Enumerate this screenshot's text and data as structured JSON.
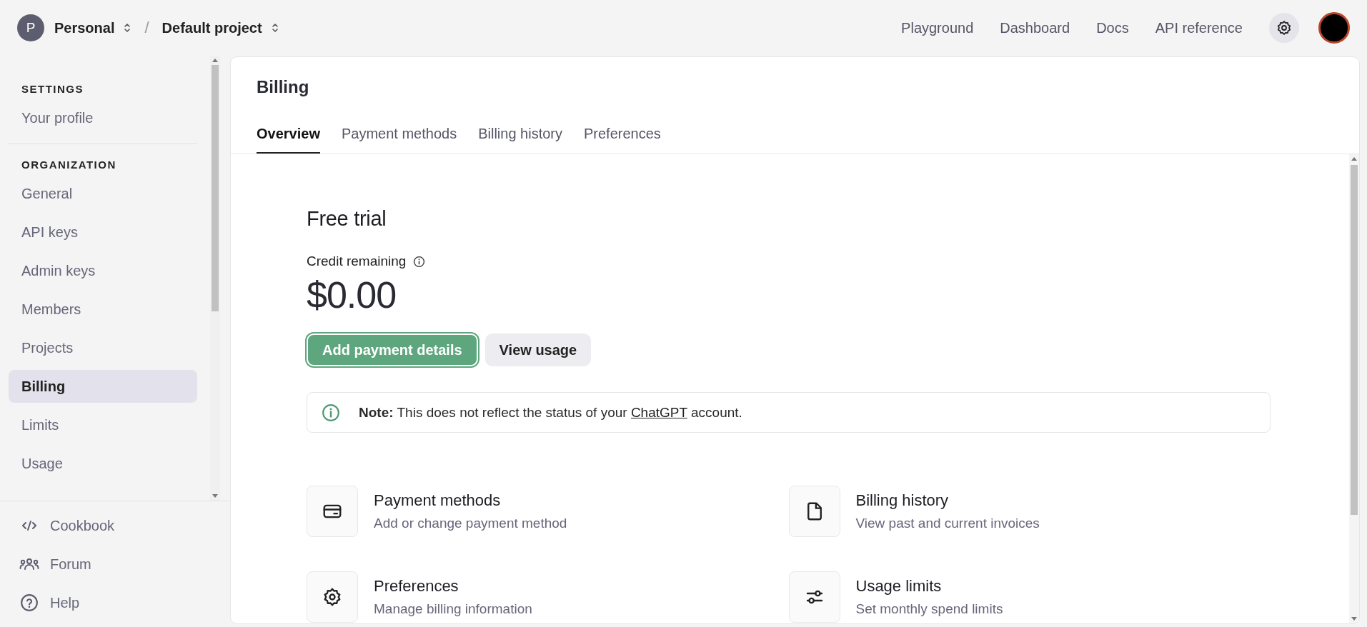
{
  "topbar": {
    "org": {
      "initial": "P",
      "name": "Personal"
    },
    "separator": "/",
    "project": "Default project",
    "nav": [
      "Playground",
      "Dashboard",
      "Docs",
      "API reference"
    ]
  },
  "sidebar": {
    "sections": [
      {
        "heading": "SETTINGS",
        "items": [
          {
            "label": "Your profile",
            "selected": false
          }
        ]
      },
      {
        "heading": "ORGANIZATION",
        "items": [
          {
            "label": "General",
            "selected": false
          },
          {
            "label": "API keys",
            "selected": false
          },
          {
            "label": "Admin keys",
            "selected": false
          },
          {
            "label": "Members",
            "selected": false
          },
          {
            "label": "Projects",
            "selected": false
          },
          {
            "label": "Billing",
            "selected": true
          },
          {
            "label": "Limits",
            "selected": false
          },
          {
            "label": "Usage",
            "selected": false
          }
        ]
      }
    ],
    "footer_links": [
      {
        "kind": "code",
        "label": "Cookbook"
      },
      {
        "kind": "people",
        "label": "Forum"
      },
      {
        "kind": "help",
        "label": "Help"
      }
    ]
  },
  "page": {
    "title": "Billing",
    "tabs": [
      {
        "label": "Overview",
        "selected": true
      },
      {
        "label": "Payment methods",
        "selected": false
      },
      {
        "label": "Billing history",
        "selected": false
      },
      {
        "label": "Preferences",
        "selected": false
      }
    ],
    "plan_title": "Free trial",
    "credit_label": "Credit remaining",
    "credit_amount": "$0.00",
    "buttons": [
      {
        "kind": "primary",
        "label": "Add payment details"
      },
      {
        "kind": "secondary",
        "label": "View usage"
      }
    ],
    "note": {
      "lead": "Note:",
      "before": "This does not reflect the status of your",
      "link": "ChatGPT",
      "after": "account."
    },
    "cards": [
      {
        "kind": "card",
        "title": "Payment methods",
        "subtitle": "Add or change payment method"
      },
      {
        "kind": "document",
        "title": "Billing history",
        "subtitle": "View past and current invoices"
      },
      {
        "kind": "gear",
        "title": "Preferences",
        "subtitle": "Manage billing information"
      },
      {
        "kind": "sliders",
        "title": "Usage limits",
        "subtitle": "Set monthly spend limits"
      }
    ]
  }
}
